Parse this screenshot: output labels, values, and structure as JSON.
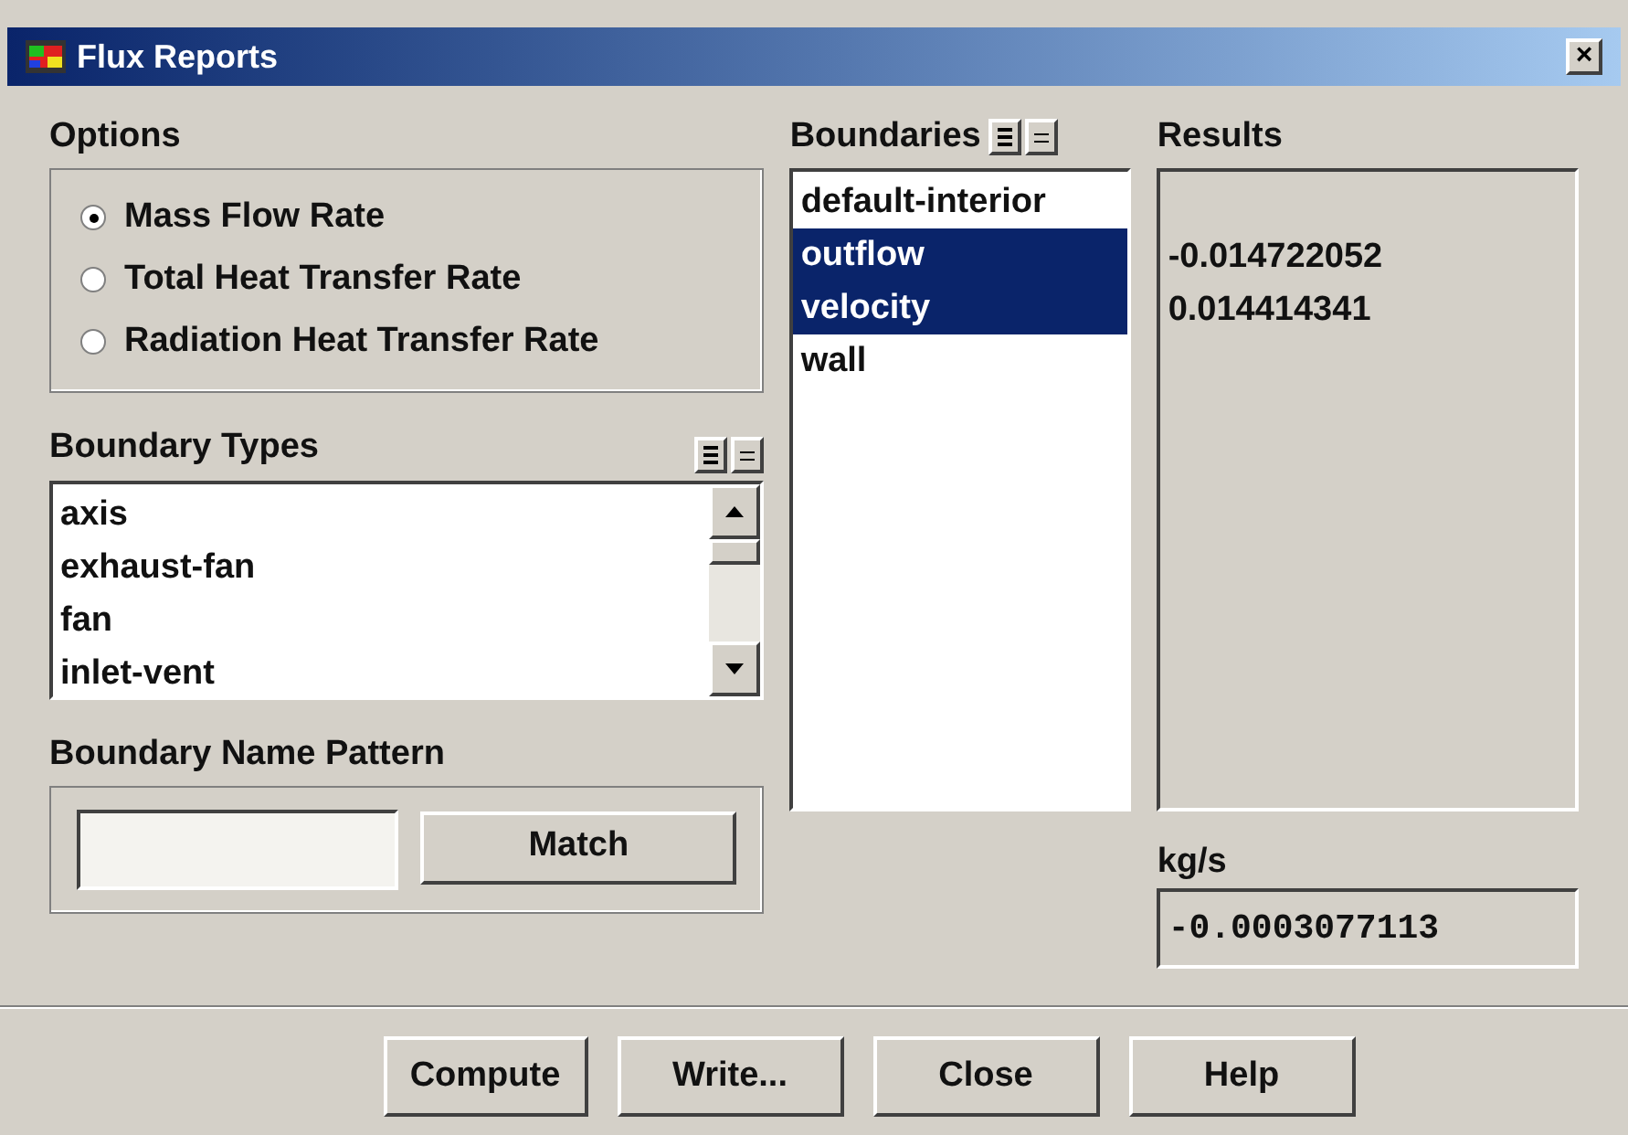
{
  "window": {
    "title": "Flux Reports",
    "close": "×"
  },
  "options": {
    "title": "Options",
    "items": [
      {
        "label": "Mass Flow Rate",
        "selected": true
      },
      {
        "label": "Total Heat Transfer Rate",
        "selected": false
      },
      {
        "label": "Radiation Heat Transfer Rate",
        "selected": false
      }
    ]
  },
  "boundary_types": {
    "title": "Boundary Types",
    "items": [
      {
        "label": "axis",
        "selected": false
      },
      {
        "label": "exhaust-fan",
        "selected": false
      },
      {
        "label": "fan",
        "selected": false
      },
      {
        "label": "inlet-vent",
        "selected": false
      }
    ]
  },
  "name_pattern": {
    "title": "Boundary Name Pattern",
    "match_button": "Match"
  },
  "boundaries": {
    "title": "Boundaries",
    "items": [
      {
        "label": "default-interior",
        "selected": false
      },
      {
        "label": "outflow",
        "selected": true
      },
      {
        "label": "velocity",
        "selected": true
      },
      {
        "label": "wall",
        "selected": false
      }
    ]
  },
  "results": {
    "title": "Results",
    "values": [
      "-0.014722052",
      "0.014414341"
    ],
    "unit": "kg/s",
    "total": "-0.0003077113"
  },
  "buttons": [
    "Compute",
    "Write...",
    "Close",
    "Help"
  ]
}
